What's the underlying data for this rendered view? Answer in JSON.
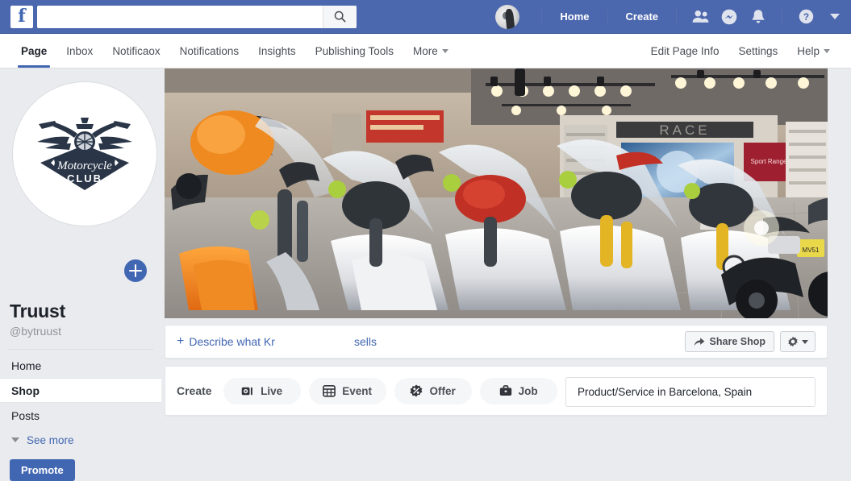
{
  "topbar": {
    "logo_text": "f",
    "search_value": "",
    "search_placeholder": "",
    "search_icon": "search-icon",
    "avatar_icon": "user-avatar",
    "links": [
      {
        "label": "Home"
      },
      {
        "label": "Create"
      }
    ],
    "icons": [
      {
        "name": "friend-requests-icon"
      },
      {
        "name": "messenger-icon"
      },
      {
        "name": "notifications-bell-icon"
      },
      {
        "name": "help-question-icon"
      }
    ],
    "account_caret": "chevron-down-icon"
  },
  "tabs": {
    "left": [
      {
        "label": "Page",
        "active": true
      },
      {
        "label": "Inbox",
        "active": false
      },
      {
        "label": "Notificaox",
        "active": false
      },
      {
        "label": "Notifications",
        "active": false
      },
      {
        "label": "Insights",
        "active": false
      },
      {
        "label": "Publishing Tools",
        "active": false
      },
      {
        "label": "More",
        "active": false,
        "caret": true
      }
    ],
    "right": [
      {
        "label": "Edit Page Info"
      },
      {
        "label": "Settings"
      },
      {
        "label": "Help",
        "caret": true
      }
    ]
  },
  "sidebar": {
    "profile_logo": {
      "name": "motorcycle-club-logo",
      "title_text": "Motorcycle",
      "subtitle_text": "CLUB"
    },
    "add_button_icon": "plus-icon",
    "page_name": "Truust",
    "page_handle": "@bytruust",
    "items": [
      {
        "label": "Home",
        "selected": false
      },
      {
        "label": "Shop",
        "selected": true
      },
      {
        "label": "Posts",
        "selected": false
      }
    ],
    "see_more_label": "See more",
    "see_more_caret": "chevron-down-icon",
    "promote_label": "Promote"
  },
  "cover": {
    "name": "cover-photo",
    "description": "Motorcycle showroom with rows of sport and touring bikes"
  },
  "describe_card": {
    "plus": "+",
    "link_label": "Describe what Kr",
    "sells_label": "sells",
    "share_label": "Share Shop",
    "share_icon": "share-arrow-icon",
    "settings_icon": "gear-icon",
    "settings_caret": "chevron-down-icon"
  },
  "create_card": {
    "label": "Create",
    "buttons": [
      {
        "label": "Live",
        "icon": "video-camera-icon"
      },
      {
        "label": "Event",
        "icon": "calendar-icon"
      },
      {
        "label": "Offer",
        "icon": "percent-tag-icon"
      },
      {
        "label": "Job",
        "icon": "briefcase-icon"
      }
    ],
    "category_field_value": "Product/Service in Barcelona, Spain"
  },
  "colors": {
    "facebook_blue": "#4267b2",
    "topbar_blue": "#4b67ad",
    "page_background": "#e9ebee",
    "card_white": "#ffffff",
    "text_dark": "#1d2129",
    "text_muted": "#90949c"
  }
}
